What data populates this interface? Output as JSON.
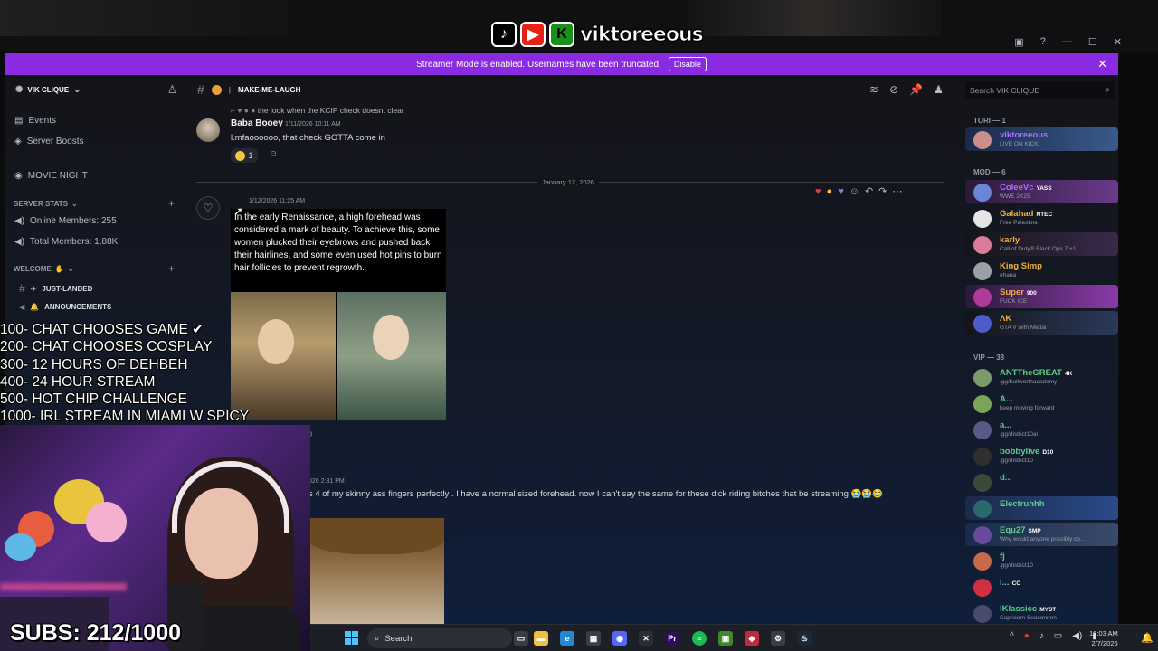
{
  "overlay": {
    "brand_name": "viktoreeous",
    "goals": [
      "100- CHAT CHOOSES GAME ✔",
      "200- CHAT CHOOSES COSPLAY",
      "300- 12 HOURS OF DEHBEH",
      "400- 24 HOUR STREAM",
      "500- HOT CHIP CHALLENGE",
      "1000- IRL STREAM IN MIAMI W SPICY"
    ],
    "subs": "SUBS: 212/1000"
  },
  "banner": {
    "text": "Streamer Mode is enabled. Usernames have been truncated.",
    "disable_label": "Disable"
  },
  "sidebar": {
    "server_name": "VIK CLIQUE",
    "items": [
      {
        "label": "Events",
        "icon": "calendar-icon"
      },
      {
        "label": "Server Boosts",
        "icon": "boost-icon"
      },
      {
        "label": "MOVIE NIGHT",
        "icon": "stage-icon"
      }
    ],
    "server_stats_label": "SERVER STATS",
    "online_members": "Online Members: 255",
    "total_members": "Total Members: 1.88K",
    "welcome_label": "WELCOME",
    "channels": [
      {
        "label": "JUST-LANDED"
      },
      {
        "label": "ANNOUNCEMENTS"
      }
    ]
  },
  "chat": {
    "channel_name": "MAKE-ME-LAUGH",
    "search_placeholder": "Search VIK CLIQUE",
    "reply_preview": "the look when the KCIP check doesnt clear",
    "messages": [
      {
        "author": "Baba Booey",
        "timestamp": "1/11/2026 10:11 AM",
        "text": "l.mfaoooooo, that check GOTTA come in",
        "reaction_count": "1"
      },
      {
        "timestamp": "1/12/2026 11:25 AM",
        "meme_text": "In the early Renaissance, a high forehead was considered a mark of beauty. To achieve this, some women plucked their eyebrows and pushed back their hairlines, and some even used hot pins to burn hair follicles to prevent regrowth."
      },
      {
        "timestamp": "026 2:31 PM",
        "text": "s 4 of my skinny ass fingers perfectly . I have a normal sized forehead. now I can't say the same for these dick riding bitches that be streaming 😭😭😂"
      }
    ],
    "date_divider": "January 12, 2026"
  },
  "members": {
    "groups": [
      {
        "label": "TORI — 1",
        "members": [
          {
            "name": "viktoreeous",
            "status": "LIVE ON KICK!",
            "color": "#a970ff",
            "avatar": "#c9908a"
          }
        ]
      },
      {
        "label": "MOD — 6",
        "members": [
          {
            "name": "ColeeVc",
            "tag": "YASS",
            "status": "WWE 2K25",
            "color": "#a970ff",
            "avatar": "#6b86d6"
          },
          {
            "name": "Galahad",
            "tag": "NTEC",
            "status": "Free Palestine",
            "color": "#f0b132",
            "avatar": "#e5e5e5"
          },
          {
            "name": "karly",
            "status": "Call of Duty® Black Ops 7 +1",
            "color": "#f0b132",
            "avatar": "#d97c9b"
          },
          {
            "name": "King Simp",
            "status": "ohana",
            "color": "#f0b132",
            "avatar": "#9aa0a6"
          },
          {
            "name": "Super",
            "tag": "900",
            "status": "FUCK ICE",
            "color": "#f0b132",
            "avatar": "#b03a9a"
          },
          {
            "name": "ΛK",
            "status": "GTA V with Medal",
            "color": "#f0b132",
            "avatar": "#4c5cc8"
          }
        ]
      },
      {
        "label": "VIP — 38",
        "members": [
          {
            "name": "ANTTheGREAT",
            "tag": "4K",
            "status": ".gg/bullworthacademy",
            "color": "#5ecc8a",
            "avatar": "#7a9a6a"
          },
          {
            "name": "A...",
            "status": "keep moving forward",
            "color": "#5ecc8a",
            "avatar": "#7ca55c"
          },
          {
            "name": "a...",
            "status": ".gg/district10al",
            "color": "#5ecc8a",
            "avatar": "#5a5a8a"
          },
          {
            "name": "bobbylive",
            "tag": "D10",
            "status": ".gg/district10",
            "color": "#5ecc8a",
            "avatar": "#2f2f2f"
          },
          {
            "name": "d...",
            "status": "",
            "color": "#5ecc8a",
            "avatar": "#3a4a3a"
          },
          {
            "name": "Electruhhh",
            "status": "",
            "color": "#5ecc8a",
            "avatar": "#2a6a6a"
          },
          {
            "name": "Equ27",
            "tag": "SMP",
            "status": "Why would anyone possibly co...",
            "color": "#5ecc8a",
            "avatar": "#6a4a9a"
          },
          {
            "name": "fj",
            "status": ".gg/district10",
            "color": "#5ecc8a",
            "avatar": "#c86a4a"
          },
          {
            "name": "l...",
            "tag": "CO",
            "status": "",
            "color": "#5ecc8a",
            "avatar": "#d03040"
          },
          {
            "name": "lKlassicc",
            "tag": "MYST",
            "status": "Capricorn Seasonnnn",
            "color": "#5ecc8a",
            "avatar": "#4a4a6a"
          }
        ]
      }
    ]
  },
  "taskbar": {
    "search_label": "Search",
    "time": "12:03 AM",
    "date": "2/7/2026"
  },
  "colors": {
    "accent": "#8a2be2",
    "discord_bg": "#141418"
  }
}
